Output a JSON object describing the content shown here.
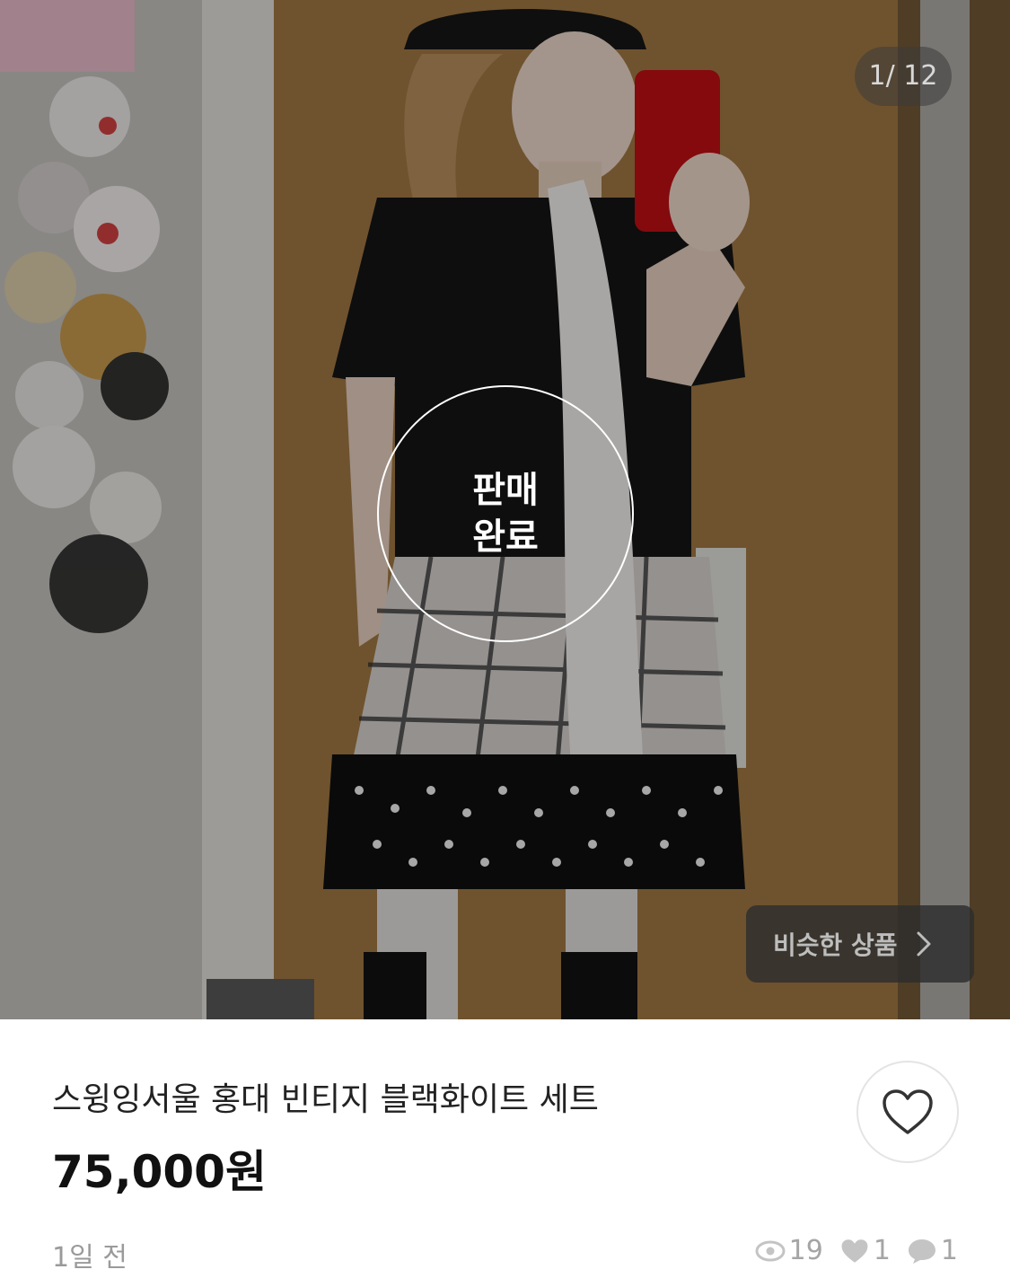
{
  "gallery": {
    "counter": "1/ 12",
    "sold_line1": "판매",
    "sold_line2": "완료",
    "similar_label": "비슷한 상품"
  },
  "product": {
    "title": "스윙잉서울 홍대 빈티지 블랙화이트 세트",
    "price": "75,000원",
    "time_ago": "1일 전",
    "views": "19",
    "likes": "1",
    "chats": "1"
  },
  "icons": {
    "like_button": "heart-outline-icon",
    "similar_arrow": "chevron-right-icon",
    "views": "eye-icon",
    "likes": "heart-icon",
    "chats": "chat-bubble-icon"
  },
  "colors": {
    "price": "#111111",
    "meta": "#9a9a9a",
    "stat_icon": "#c4c4c4"
  }
}
